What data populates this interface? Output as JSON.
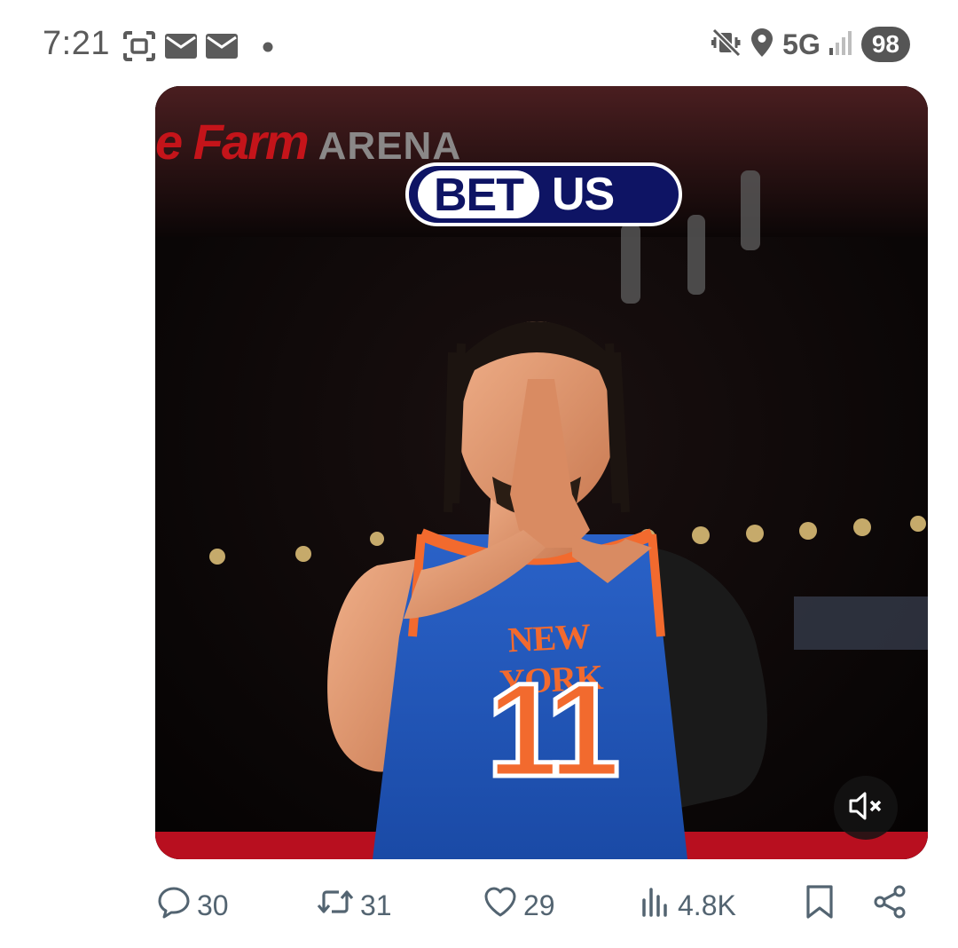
{
  "status_bar": {
    "time": "7:21",
    "left_icons": [
      "screenshot-icon",
      "mail-icon",
      "mail-icon",
      "dot-icon"
    ],
    "network": "5G",
    "battery": "98",
    "right_icons": [
      "vibrate-mute-icon",
      "location-icon",
      "signal-icon"
    ]
  },
  "media": {
    "sponsor": {
      "left": "BET",
      "right": "US"
    },
    "arena_sign": {
      "brand": "e Farm",
      "word": "ARENA"
    },
    "jersey": {
      "team": "NEW YORK",
      "number": "11"
    },
    "mute_icon": "volume-muted-icon"
  },
  "actions": {
    "replies": "30",
    "reposts": "31",
    "likes": "29",
    "views": "4.8K"
  },
  "colors": {
    "action_gray": "#536471",
    "knicks_blue": "#1d55b8",
    "knicks_orange": "#f26a2e",
    "sponsor_navy": "#0e1464"
  }
}
